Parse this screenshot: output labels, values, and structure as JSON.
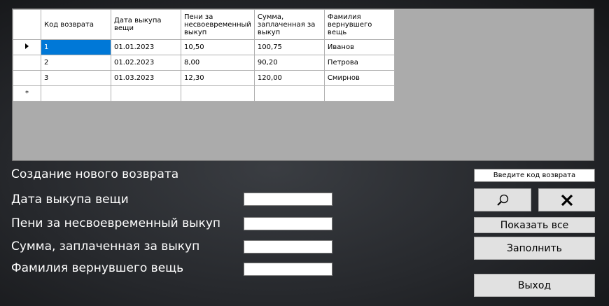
{
  "grid": {
    "headers": [
      "Код возврата",
      "Дата выкупа вещи",
      "Пени за несвоевременный выкуп",
      "Сумма, заплаченная за выкуп",
      "Фамилия вернувшего вещь"
    ],
    "rows": [
      [
        "1",
        "01.01.2023",
        "10,50",
        "100,75",
        "Иванов"
      ],
      [
        "2",
        "01.02.2023",
        "8,00",
        "90,20",
        "Петрова"
      ],
      [
        "3",
        "01.03.2023",
        "12,30",
        "120,00",
        "Смирнов"
      ]
    ],
    "new_row_marker": "*"
  },
  "form": {
    "title": "Создание нового возврата",
    "date_label": "Дата выкупа вещи",
    "penalty_label": "Пени за несвоевременный выкуп",
    "sum_label": "Сумма, заплаченная за выкуп",
    "surname_label": "Фамилия вернувшего вещь",
    "date_value": "",
    "penalty_value": "",
    "sum_value": "",
    "surname_value": ""
  },
  "search": {
    "value": "Введите код возврата"
  },
  "buttons": {
    "search_icon": "magnifier-icon",
    "clear_icon": "close-x-icon",
    "show_all": "Показать все",
    "fill": "Заполнить",
    "exit": "Выход"
  },
  "colors": {
    "selection": "#0078d7",
    "grid_background": "#ababab"
  }
}
